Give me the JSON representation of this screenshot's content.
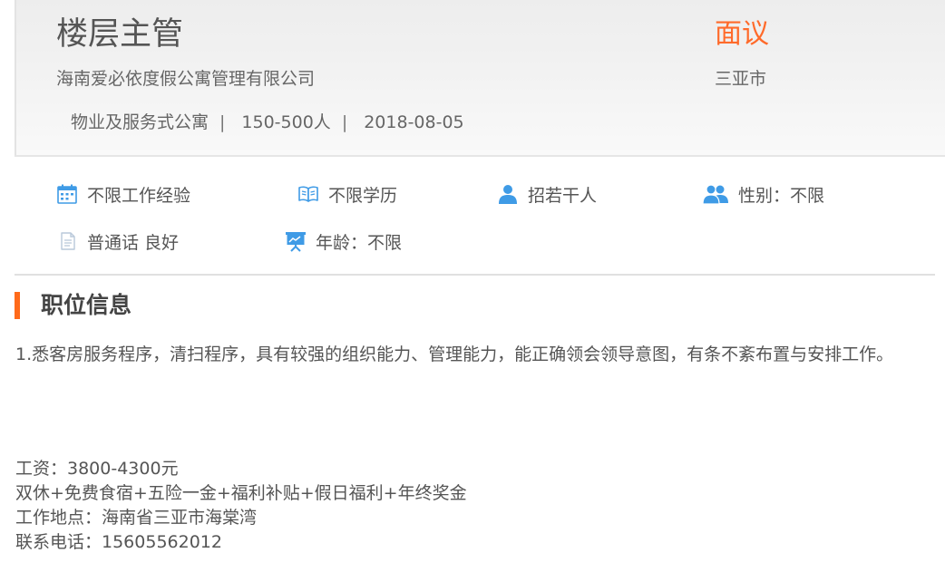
{
  "job": {
    "title": "楼层主管",
    "salary": "面议",
    "company": "海南爱必依度假公寓管理有限公司",
    "city": "三亚市",
    "meta": {
      "industry": "物业及服务式公寓",
      "size": "150-500人",
      "date": "2018-08-05",
      "separator": "|"
    }
  },
  "requirements": [
    {
      "icon": "calendar-icon",
      "label": "不限工作经验"
    },
    {
      "icon": "book-icon",
      "label": "不限学历"
    },
    {
      "icon": "person-icon",
      "label": "招若干人"
    },
    {
      "icon": "people-icon",
      "label": "性别：不限"
    },
    {
      "icon": "document-icon",
      "label": "普通话 良好"
    },
    {
      "icon": "presentation-board-icon",
      "label": "年龄：不限"
    }
  ],
  "section": {
    "title": "职位信息",
    "description": "1.悉客房服务程序，清扫程序，具有较强的组织能力、管理能力，能正确领会领导意图，有条不紊布置与安排工作。",
    "details": [
      "工资：3800-4300元",
      "双休+免费食宿+五险一金+福利补贴+假日福利+年终奖金",
      "工作地点：海南省三亚市海棠湾",
      "联系电话：15605562012"
    ]
  },
  "colors": {
    "accent": "#ff6a2a",
    "icon_blue": "#3f9be6",
    "text": "#555555"
  }
}
